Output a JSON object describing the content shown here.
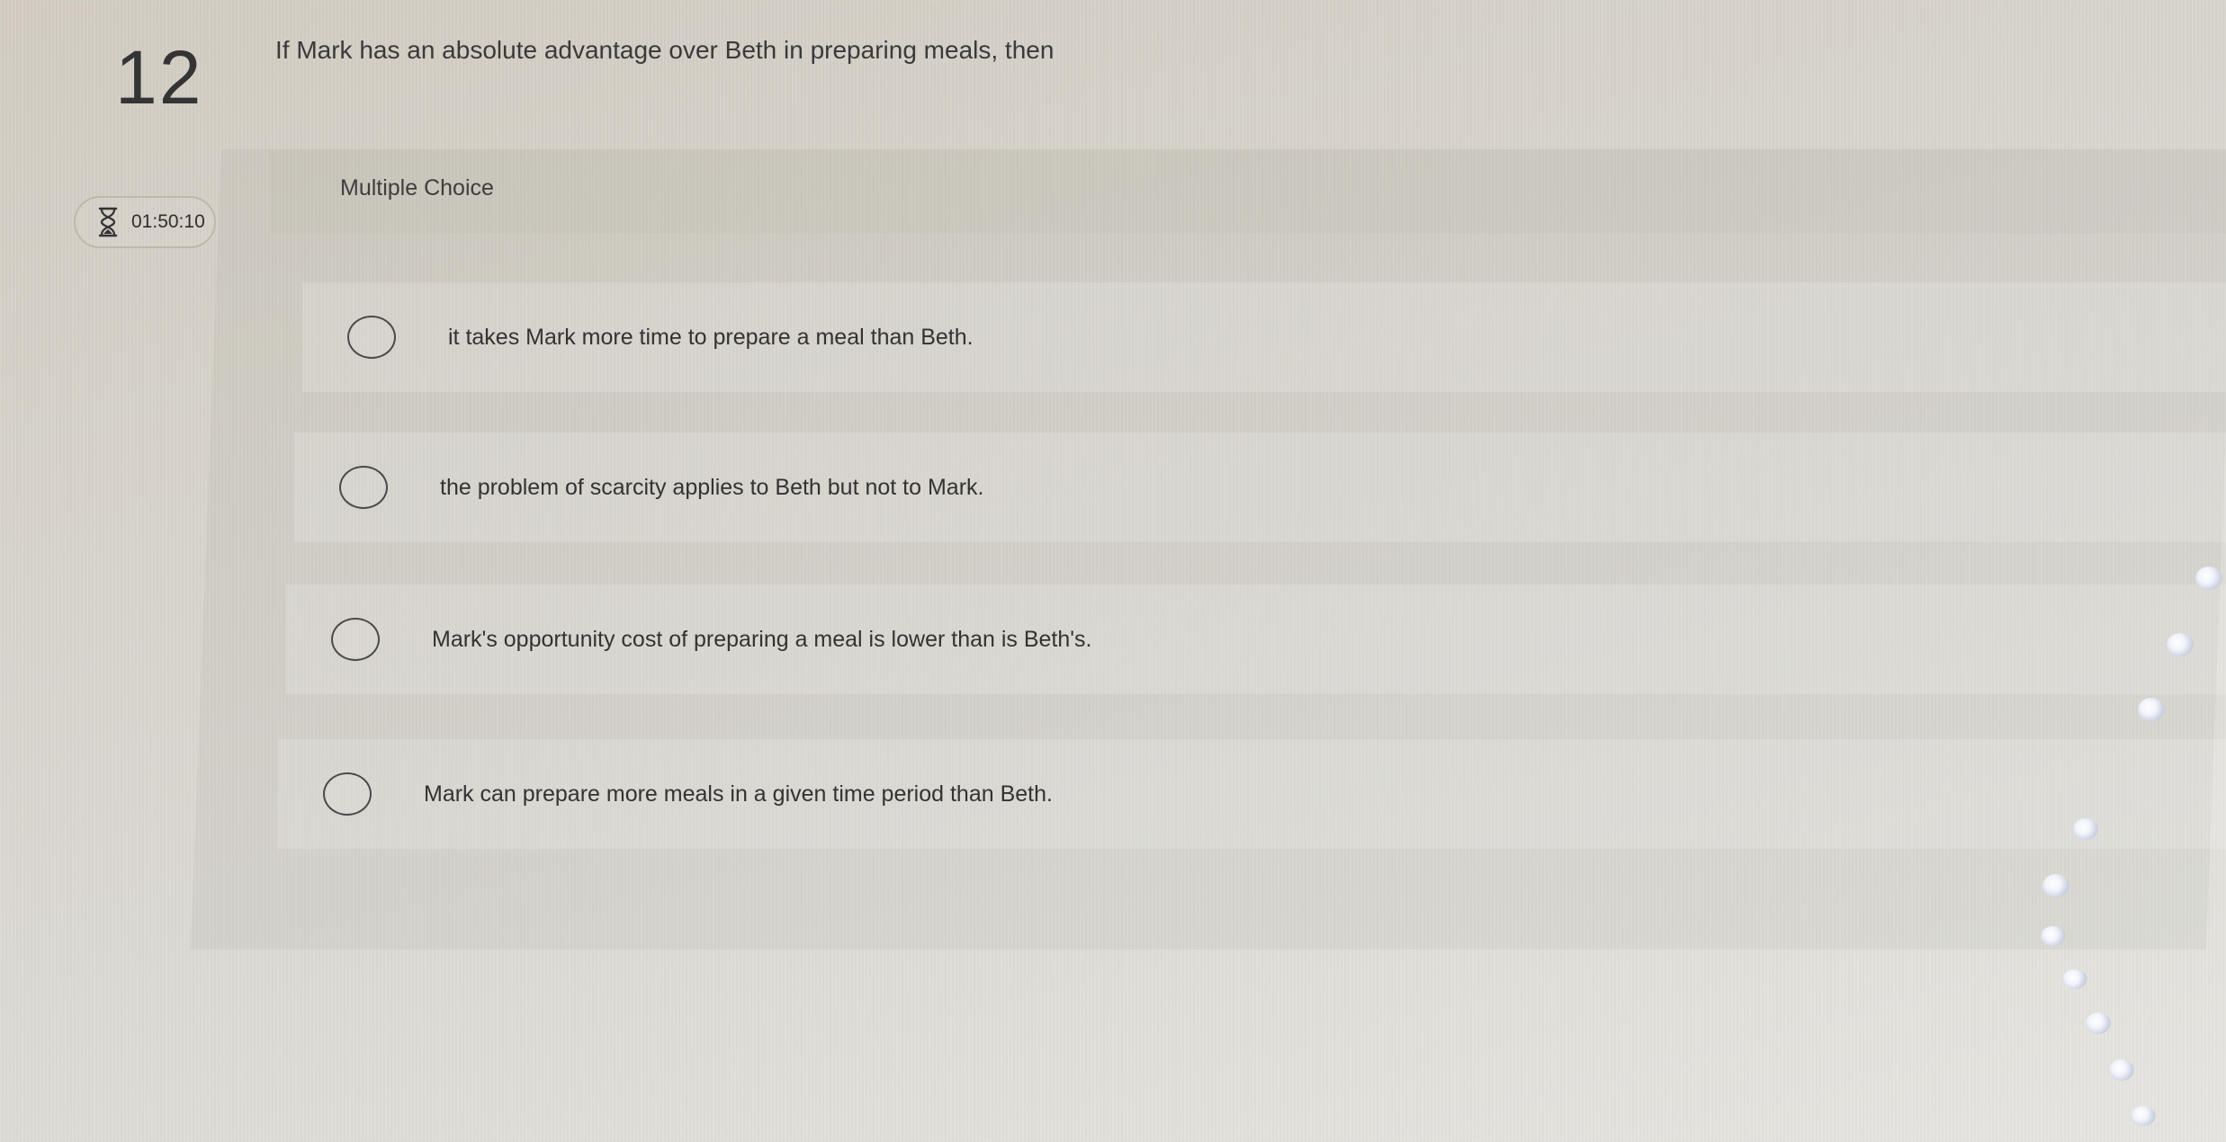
{
  "question": {
    "number": "12",
    "text": "If Mark has an absolute advantage over Beth in preparing meals, then"
  },
  "timer": {
    "icon": "hourglass-icon",
    "value": "01:50:10"
  },
  "answer_panel": {
    "type_label": "Multiple Choice",
    "options": [
      {
        "label": "it takes Mark more time to prepare a meal than Beth.",
        "selected": false
      },
      {
        "label": "the problem of scarcity applies to Beth but not to Mark.",
        "selected": false
      },
      {
        "label": "Mark's opportunity cost of preparing a meal is lower than is Beth's.",
        "selected": false
      },
      {
        "label": "Mark can prepare more meals in a given time period than Beth.",
        "selected": false
      }
    ]
  },
  "colors": {
    "background": "#d8d5ce",
    "text": "#333333",
    "radio_border": "#4a4a4a"
  }
}
